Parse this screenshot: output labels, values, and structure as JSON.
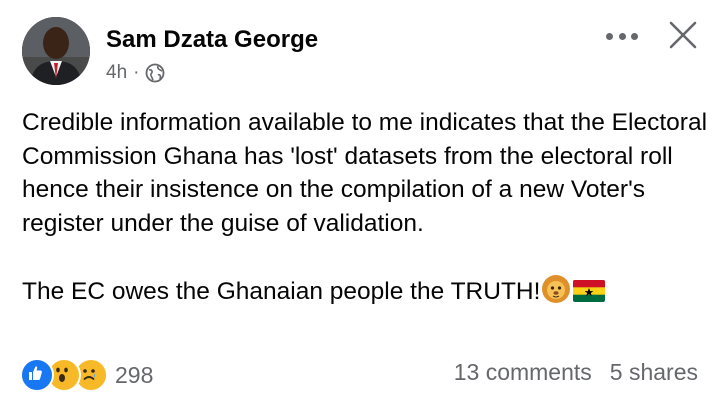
{
  "post": {
    "author": "Sam Dzata George",
    "time": "4h",
    "separator": "·",
    "paragraph1": "Credible information available to me indicates that the Electoral Commission Ghana has 'lost' datasets from the electoral roll hence their insistence on the compilation of a new Voter's register under the guise of validation.",
    "paragraph2": "The EC owes the Ghanaian people the TRUTH!"
  },
  "engagement": {
    "reaction_count": "298",
    "comments": "13 comments",
    "shares": "5 shares",
    "reaction_icons": [
      "like-icon",
      "wow-icon",
      "sad-icon"
    ]
  },
  "icons": {
    "privacy": "globe-icon",
    "more": "more-options-icon",
    "close": "close-icon",
    "emojis": [
      "lion-face-emoji",
      "ghana-flag-emoji"
    ]
  },
  "colors": {
    "text": "#050505",
    "secondary": "#65676b",
    "like_blue": "#1877f2",
    "reaction_yellow": "#f7b928"
  }
}
